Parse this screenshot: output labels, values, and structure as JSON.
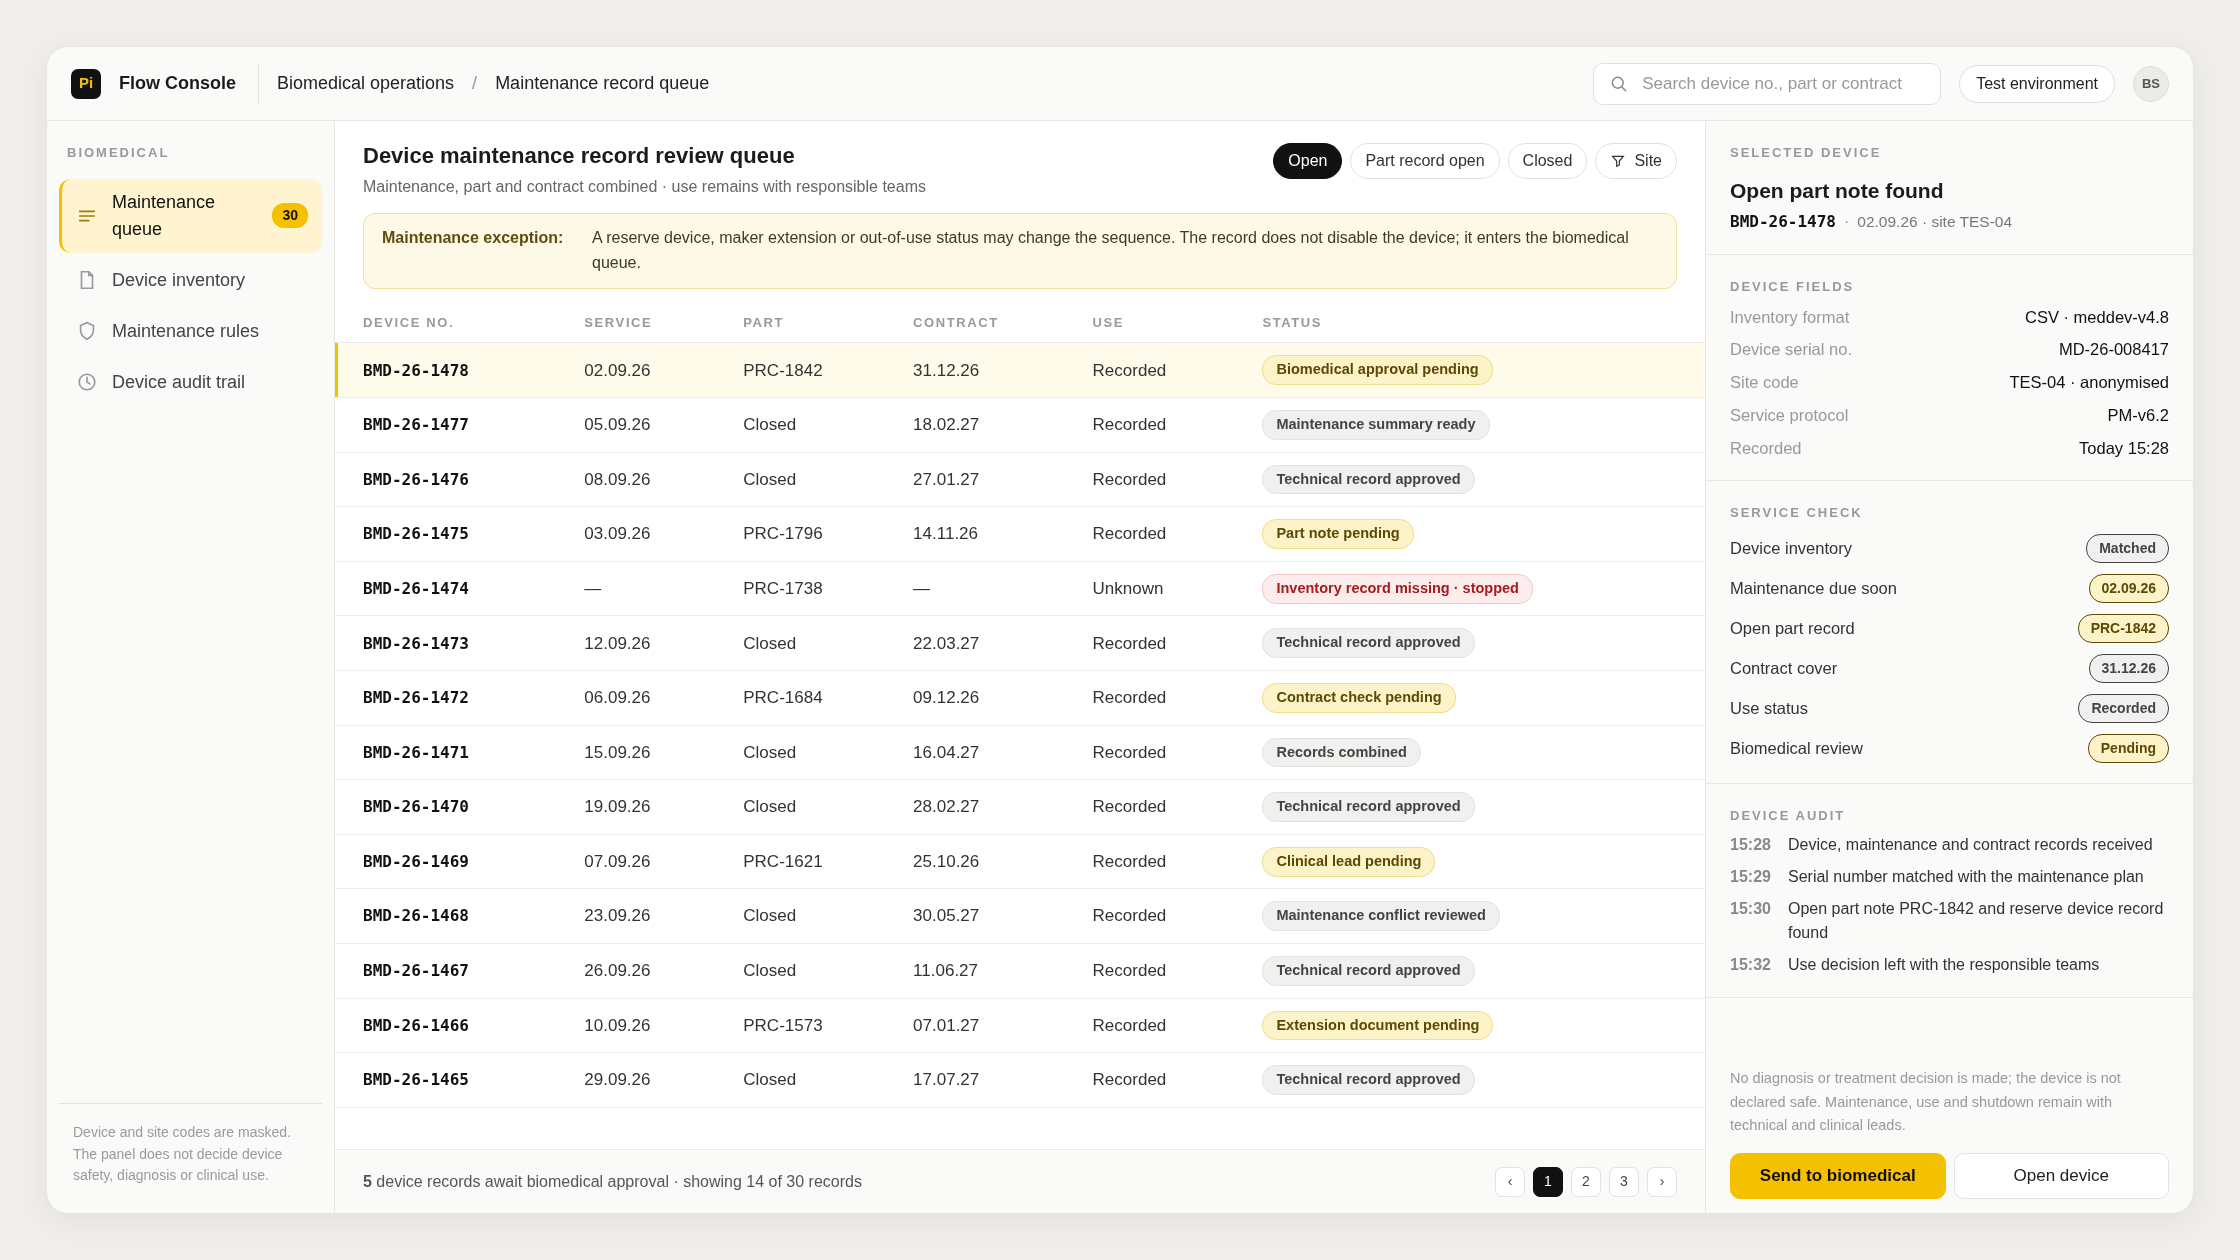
{
  "header": {
    "logo": "Pi",
    "app_name": "Flow Console",
    "breadcrumb": [
      "Biomedical operations",
      "Maintenance record queue"
    ],
    "breadcrumb_separator": "/",
    "search": {
      "placeholder": "Search device no., part or contract"
    },
    "environment": "Test environment",
    "avatar": "BS"
  },
  "sidebar": {
    "section": "BIOMEDICAL",
    "items": [
      {
        "label": "Maintenance queue",
        "badge": "30",
        "selected": true
      },
      {
        "label": "Device inventory",
        "selected": false
      },
      {
        "label": "Maintenance rules",
        "selected": false
      },
      {
        "label": "Device audit trail",
        "selected": false
      }
    ],
    "note": "Device and site codes are masked. The panel does not decide device safety, diagnosis or clinical use."
  },
  "main": {
    "title": "Device maintenance record review queue",
    "subtitle": "Maintenance, part and contract combined · use remains with responsible teams",
    "filters": [
      {
        "label": "Open",
        "kind": "toggle",
        "selected": true
      },
      {
        "label": "Part record open",
        "kind": "toggle",
        "selected": false
      },
      {
        "label": "Closed",
        "kind": "toggle",
        "selected": false
      },
      {
        "label": "Site",
        "kind": "filter",
        "selected": false
      }
    ],
    "notice": {
      "label": "Maintenance exception:",
      "text": "A reserve device, maker extension or out-of-use status may change the sequence. The record does not disable the device; it enters the biomedical queue."
    },
    "table": {
      "columns": [
        "DEVICE NO.",
        "SERVICE",
        "PART",
        "CONTRACT",
        "USE",
        "STATUS"
      ],
      "rows": [
        {
          "device_no": "BMD-26-1478",
          "service": "02.09.26",
          "part": "PRC-1842",
          "contract": "31.12.26",
          "use": "Recorded",
          "status": {
            "label": "Biomedical approval pending",
            "kind": "warning"
          },
          "selected": true
        },
        {
          "device_no": "BMD-26-1477",
          "service": "05.09.26",
          "part": "Closed",
          "contract": "18.02.27",
          "use": "Recorded",
          "status": {
            "label": "Maintenance summary ready",
            "kind": "neutral"
          },
          "selected": false
        },
        {
          "device_no": "BMD-26-1476",
          "service": "08.09.26",
          "part": "Closed",
          "contract": "27.01.27",
          "use": "Recorded",
          "status": {
            "label": "Technical record approved",
            "kind": "neutral"
          },
          "selected": false
        },
        {
          "device_no": "BMD-26-1475",
          "service": "03.09.26",
          "part": "PRC-1796",
          "contract": "14.11.26",
          "use": "Recorded",
          "status": {
            "label": "Part note pending",
            "kind": "warning"
          },
          "selected": false
        },
        {
          "device_no": "BMD-26-1474",
          "service": "—",
          "part": "PRC-1738",
          "contract": "—",
          "use": "Unknown",
          "status": {
            "label": "Inventory record missing · stopped",
            "kind": "danger"
          },
          "selected": false
        },
        {
          "device_no": "BMD-26-1473",
          "service": "12.09.26",
          "part": "Closed",
          "contract": "22.03.27",
          "use": "Recorded",
          "status": {
            "label": "Technical record approved",
            "kind": "neutral"
          },
          "selected": false
        },
        {
          "device_no": "BMD-26-1472",
          "service": "06.09.26",
          "part": "PRC-1684",
          "contract": "09.12.26",
          "use": "Recorded",
          "status": {
            "label": "Contract check pending",
            "kind": "warning"
          },
          "selected": false
        },
        {
          "device_no": "BMD-26-1471",
          "service": "15.09.26",
          "part": "Closed",
          "contract": "16.04.27",
          "use": "Recorded",
          "status": {
            "label": "Records combined",
            "kind": "neutral"
          },
          "selected": false
        },
        {
          "device_no": "BMD-26-1470",
          "service": "19.09.26",
          "part": "Closed",
          "contract": "28.02.27",
          "use": "Recorded",
          "status": {
            "label": "Technical record approved",
            "kind": "neutral"
          },
          "selected": false
        },
        {
          "device_no": "BMD-26-1469",
          "service": "07.09.26",
          "part": "PRC-1621",
          "contract": "25.10.26",
          "use": "Recorded",
          "status": {
            "label": "Clinical lead pending",
            "kind": "warning"
          },
          "selected": false
        },
        {
          "device_no": "BMD-26-1468",
          "service": "23.09.26",
          "part": "Closed",
          "contract": "30.05.27",
          "use": "Recorded",
          "status": {
            "label": "Maintenance conflict reviewed",
            "kind": "neutral"
          },
          "selected": false
        },
        {
          "device_no": "BMD-26-1467",
          "service": "26.09.26",
          "part": "Closed",
          "contract": "11.06.27",
          "use": "Recorded",
          "status": {
            "label": "Technical record approved",
            "kind": "neutral"
          },
          "selected": false
        },
        {
          "device_no": "BMD-26-1466",
          "service": "10.09.26",
          "part": "PRC-1573",
          "contract": "07.01.27",
          "use": "Recorded",
          "status": {
            "label": "Extension document pending",
            "kind": "warning"
          },
          "selected": false
        },
        {
          "device_no": "BMD-26-1465",
          "service": "29.09.26",
          "part": "Closed",
          "contract": "17.07.27",
          "use": "Recorded",
          "status": {
            "label": "Technical record approved",
            "kind": "neutral"
          },
          "selected": false
        }
      ]
    },
    "footer": {
      "summary": "**5** device records await biomedical approval · showing 14 of 30 records",
      "prev": "‹",
      "next": "›",
      "pages": [
        {
          "label": "1",
          "selected": true
        },
        {
          "label": "2",
          "selected": false
        },
        {
          "label": "3",
          "selected": false
        }
      ]
    }
  },
  "details": {
    "section": "SELECTED DEVICE",
    "title": "Open part note found",
    "device_no": "BMD-26-1478",
    "separator": "·",
    "meta": "02.09.26 · site TES-04",
    "fields_section": "DEVICE FIELDS",
    "fields": [
      {
        "label": "Inventory format",
        "value": "CSV · meddev-v4.8"
      },
      {
        "label": "Device serial no.",
        "value": "MD-26-008417"
      },
      {
        "label": "Site code",
        "value": "TES-04 · anonymised"
      },
      {
        "label": "Service protocol",
        "value": "PM-v6.2"
      },
      {
        "label": "Recorded",
        "value": "Today 15:28"
      }
    ],
    "check_section": "SERVICE CHECK",
    "checks": [
      {
        "label": "Device inventory",
        "value": "Matched",
        "kind": "neutral"
      },
      {
        "label": "Maintenance due soon",
        "value": "02.09.26",
        "kind": "warning"
      },
      {
        "label": "Open part record",
        "value": "PRC-1842",
        "kind": "warning"
      },
      {
        "label": "Contract cover",
        "value": "31.12.26",
        "kind": "neutral"
      },
      {
        "label": "Use status",
        "value": "Recorded",
        "kind": "neutral"
      },
      {
        "label": "Biomedical review",
        "value": "Pending",
        "kind": "warning"
      }
    ],
    "audit_section": "DEVICE AUDIT",
    "audit": [
      {
        "time": "15:28",
        "text": "Device, maintenance and contract records received"
      },
      {
        "time": "15:29",
        "text": "Serial number matched with the maintenance plan"
      },
      {
        "time": "15:30",
        "text": "Open part note PRC-1842 and reserve device record found"
      },
      {
        "time": "15:32",
        "text": "Use decision left with the responsible teams"
      }
    ],
    "disclaimer": "No diagnosis or treatment decision is made; the device is not declared safe. Maintenance, use and shutdown remain with technical and clinical leads.",
    "buttons": [
      {
        "label": "Send to biomedical",
        "kind": "primary"
      },
      {
        "label": "Open device",
        "kind": "secondary"
      }
    ]
  }
}
